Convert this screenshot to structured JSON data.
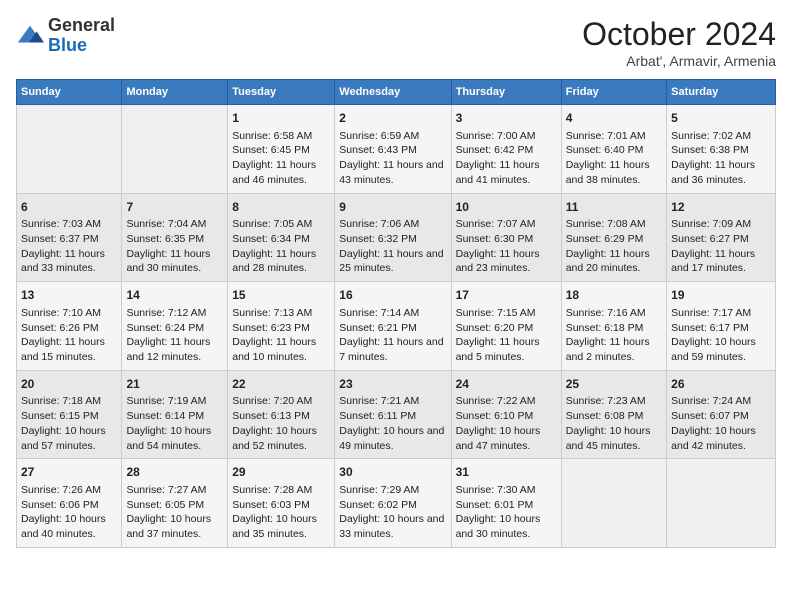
{
  "header": {
    "logo": {
      "general": "General",
      "blue": "Blue"
    },
    "title": "October 2024",
    "location": "Arbat', Armavir, Armenia"
  },
  "weekdays": [
    "Sunday",
    "Monday",
    "Tuesday",
    "Wednesday",
    "Thursday",
    "Friday",
    "Saturday"
  ],
  "weeks": [
    [
      {
        "day": "",
        "empty": true
      },
      {
        "day": "",
        "empty": true
      },
      {
        "day": "1",
        "sunrise": "Sunrise: 6:58 AM",
        "sunset": "Sunset: 6:45 PM",
        "daylight": "Daylight: 11 hours and 46 minutes."
      },
      {
        "day": "2",
        "sunrise": "Sunrise: 6:59 AM",
        "sunset": "Sunset: 6:43 PM",
        "daylight": "Daylight: 11 hours and 43 minutes."
      },
      {
        "day": "3",
        "sunrise": "Sunrise: 7:00 AM",
        "sunset": "Sunset: 6:42 PM",
        "daylight": "Daylight: 11 hours and 41 minutes."
      },
      {
        "day": "4",
        "sunrise": "Sunrise: 7:01 AM",
        "sunset": "Sunset: 6:40 PM",
        "daylight": "Daylight: 11 hours and 38 minutes."
      },
      {
        "day": "5",
        "sunrise": "Sunrise: 7:02 AM",
        "sunset": "Sunset: 6:38 PM",
        "daylight": "Daylight: 11 hours and 36 minutes."
      }
    ],
    [
      {
        "day": "6",
        "sunrise": "Sunrise: 7:03 AM",
        "sunset": "Sunset: 6:37 PM",
        "daylight": "Daylight: 11 hours and 33 minutes."
      },
      {
        "day": "7",
        "sunrise": "Sunrise: 7:04 AM",
        "sunset": "Sunset: 6:35 PM",
        "daylight": "Daylight: 11 hours and 30 minutes."
      },
      {
        "day": "8",
        "sunrise": "Sunrise: 7:05 AM",
        "sunset": "Sunset: 6:34 PM",
        "daylight": "Daylight: 11 hours and 28 minutes."
      },
      {
        "day": "9",
        "sunrise": "Sunrise: 7:06 AM",
        "sunset": "Sunset: 6:32 PM",
        "daylight": "Daylight: 11 hours and 25 minutes."
      },
      {
        "day": "10",
        "sunrise": "Sunrise: 7:07 AM",
        "sunset": "Sunset: 6:30 PM",
        "daylight": "Daylight: 11 hours and 23 minutes."
      },
      {
        "day": "11",
        "sunrise": "Sunrise: 7:08 AM",
        "sunset": "Sunset: 6:29 PM",
        "daylight": "Daylight: 11 hours and 20 minutes."
      },
      {
        "day": "12",
        "sunrise": "Sunrise: 7:09 AM",
        "sunset": "Sunset: 6:27 PM",
        "daylight": "Daylight: 11 hours and 17 minutes."
      }
    ],
    [
      {
        "day": "13",
        "sunrise": "Sunrise: 7:10 AM",
        "sunset": "Sunset: 6:26 PM",
        "daylight": "Daylight: 11 hours and 15 minutes."
      },
      {
        "day": "14",
        "sunrise": "Sunrise: 7:12 AM",
        "sunset": "Sunset: 6:24 PM",
        "daylight": "Daylight: 11 hours and 12 minutes."
      },
      {
        "day": "15",
        "sunrise": "Sunrise: 7:13 AM",
        "sunset": "Sunset: 6:23 PM",
        "daylight": "Daylight: 11 hours and 10 minutes."
      },
      {
        "day": "16",
        "sunrise": "Sunrise: 7:14 AM",
        "sunset": "Sunset: 6:21 PM",
        "daylight": "Daylight: 11 hours and 7 minutes."
      },
      {
        "day": "17",
        "sunrise": "Sunrise: 7:15 AM",
        "sunset": "Sunset: 6:20 PM",
        "daylight": "Daylight: 11 hours and 5 minutes."
      },
      {
        "day": "18",
        "sunrise": "Sunrise: 7:16 AM",
        "sunset": "Sunset: 6:18 PM",
        "daylight": "Daylight: 11 hours and 2 minutes."
      },
      {
        "day": "19",
        "sunrise": "Sunrise: 7:17 AM",
        "sunset": "Sunset: 6:17 PM",
        "daylight": "Daylight: 10 hours and 59 minutes."
      }
    ],
    [
      {
        "day": "20",
        "sunrise": "Sunrise: 7:18 AM",
        "sunset": "Sunset: 6:15 PM",
        "daylight": "Daylight: 10 hours and 57 minutes."
      },
      {
        "day": "21",
        "sunrise": "Sunrise: 7:19 AM",
        "sunset": "Sunset: 6:14 PM",
        "daylight": "Daylight: 10 hours and 54 minutes."
      },
      {
        "day": "22",
        "sunrise": "Sunrise: 7:20 AM",
        "sunset": "Sunset: 6:13 PM",
        "daylight": "Daylight: 10 hours and 52 minutes."
      },
      {
        "day": "23",
        "sunrise": "Sunrise: 7:21 AM",
        "sunset": "Sunset: 6:11 PM",
        "daylight": "Daylight: 10 hours and 49 minutes."
      },
      {
        "day": "24",
        "sunrise": "Sunrise: 7:22 AM",
        "sunset": "Sunset: 6:10 PM",
        "daylight": "Daylight: 10 hours and 47 minutes."
      },
      {
        "day": "25",
        "sunrise": "Sunrise: 7:23 AM",
        "sunset": "Sunset: 6:08 PM",
        "daylight": "Daylight: 10 hours and 45 minutes."
      },
      {
        "day": "26",
        "sunrise": "Sunrise: 7:24 AM",
        "sunset": "Sunset: 6:07 PM",
        "daylight": "Daylight: 10 hours and 42 minutes."
      }
    ],
    [
      {
        "day": "27",
        "sunrise": "Sunrise: 7:26 AM",
        "sunset": "Sunset: 6:06 PM",
        "daylight": "Daylight: 10 hours and 40 minutes."
      },
      {
        "day": "28",
        "sunrise": "Sunrise: 7:27 AM",
        "sunset": "Sunset: 6:05 PM",
        "daylight": "Daylight: 10 hours and 37 minutes."
      },
      {
        "day": "29",
        "sunrise": "Sunrise: 7:28 AM",
        "sunset": "Sunset: 6:03 PM",
        "daylight": "Daylight: 10 hours and 35 minutes."
      },
      {
        "day": "30",
        "sunrise": "Sunrise: 7:29 AM",
        "sunset": "Sunset: 6:02 PM",
        "daylight": "Daylight: 10 hours and 33 minutes."
      },
      {
        "day": "31",
        "sunrise": "Sunrise: 7:30 AM",
        "sunset": "Sunset: 6:01 PM",
        "daylight": "Daylight: 10 hours and 30 minutes."
      },
      {
        "day": "",
        "empty": true
      },
      {
        "day": "",
        "empty": true
      }
    ]
  ]
}
